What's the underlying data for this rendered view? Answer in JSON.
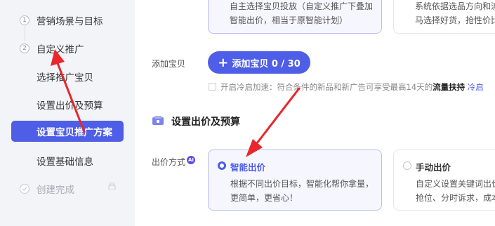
{
  "sidebar": {
    "steps": [
      {
        "num": "1",
        "label": "营销场景与目标"
      },
      {
        "num": "2",
        "label": "自定义推广"
      }
    ],
    "sub_items": [
      "选择推广宝贝",
      "设置出价及预算",
      "设置宝贝推广方案",
      "设置基础信息"
    ],
    "done_label": "创建完成"
  },
  "plan_cards": {
    "custom_desc_1": "自主选择宝贝投放（自定义推广下叠加",
    "custom_desc_2": "智能出价，相当于原智能计划）",
    "auto_desc_1": "系统依据选品方向和流",
    "auto_desc_2": "马选择好货，抢性价比"
  },
  "add_item": {
    "label": "添加宝贝",
    "button_plus": "+",
    "button_label": "添加宝贝 0 / 30"
  },
  "cold_start": {
    "text": "开启冷启加速：符合条件的新品和新广告可享受最高14天的",
    "bold": "流量扶持",
    "link": "冷启"
  },
  "bid_section": {
    "title": "设置出价及预算",
    "bid_label": "出价方式",
    "ai_badge": "AI",
    "smart": {
      "title": "智能出价",
      "desc_1": "根据不同出价目标，智能化帮你拿量，",
      "desc_2": "更简单，更省心！"
    },
    "manual": {
      "title": "手动出价",
      "desc_1": "自定义设置关键词出价",
      "desc_2": "抢位、分时诉求，成本"
    }
  },
  "colors": {
    "accent": "#4e5ee6",
    "annotation_arrow": "#e8262b"
  }
}
